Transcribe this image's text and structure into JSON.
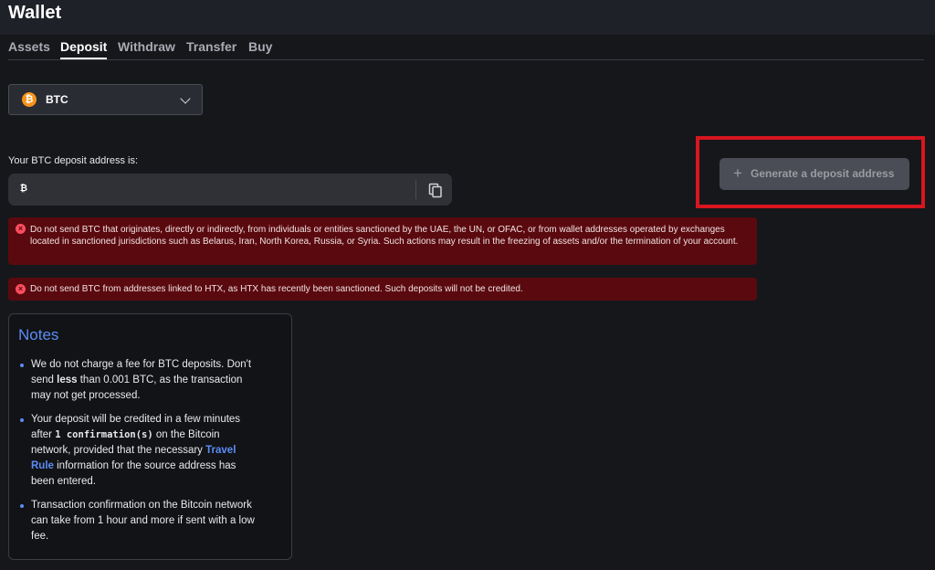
{
  "app": {
    "title": "Wallet"
  },
  "tabs": [
    {
      "label": "Assets"
    },
    {
      "label": "Deposit"
    },
    {
      "label": "Withdraw"
    },
    {
      "label": "Transfer"
    },
    {
      "label": "Buy"
    }
  ],
  "coin_select": {
    "selected": "BTC",
    "icon": "bitcoin-icon"
  },
  "address": {
    "label": "Your BTC deposit address is:",
    "value": "",
    "icon": "bitcoin-icon",
    "copy_icon": "copy-icon"
  },
  "generate_button": {
    "label": "Generate a deposit address",
    "icon": "plus-icon"
  },
  "warnings": [
    "Do not send BTC that originates, directly or indirectly, from individuals or entities sanctioned by the UAE, the UN, or OFAC, or from wallet addresses operated by exchanges located in sanctioned jurisdictions such as Belarus, Iran, North Korea, Russia, or Syria. Such actions may result in the freezing of assets and/or the termination of your account.",
    "Do not send BTC from addresses linked to HTX, as HTX has recently been sanctioned. Such deposits will not be credited."
  ],
  "notes": {
    "title": "Notes",
    "item1": {
      "text_a": "We do not charge a fee for BTC deposits. Don't send ",
      "bold": "less",
      "text_b": " than 0.001 BTC, as the transaction may not get processed."
    },
    "item2": {
      "text_a": "Your deposit will be credited in a few minutes after ",
      "mono": "1 confirmation(s)",
      "text_b": " on the Bitcoin network, provided that the necessary ",
      "link": "Travel Rule",
      "text_c": " information for the source address has been entered."
    },
    "item3": {
      "text": "Transaction confirmation on the Bitcoin network can take from 1 hour and more if sent with a low fee."
    }
  },
  "colors": {
    "accent": "#5b8df5",
    "warning_bg": "#5a0a0f",
    "highlight": "#d7161f",
    "bitcoin": "#f7931a"
  }
}
